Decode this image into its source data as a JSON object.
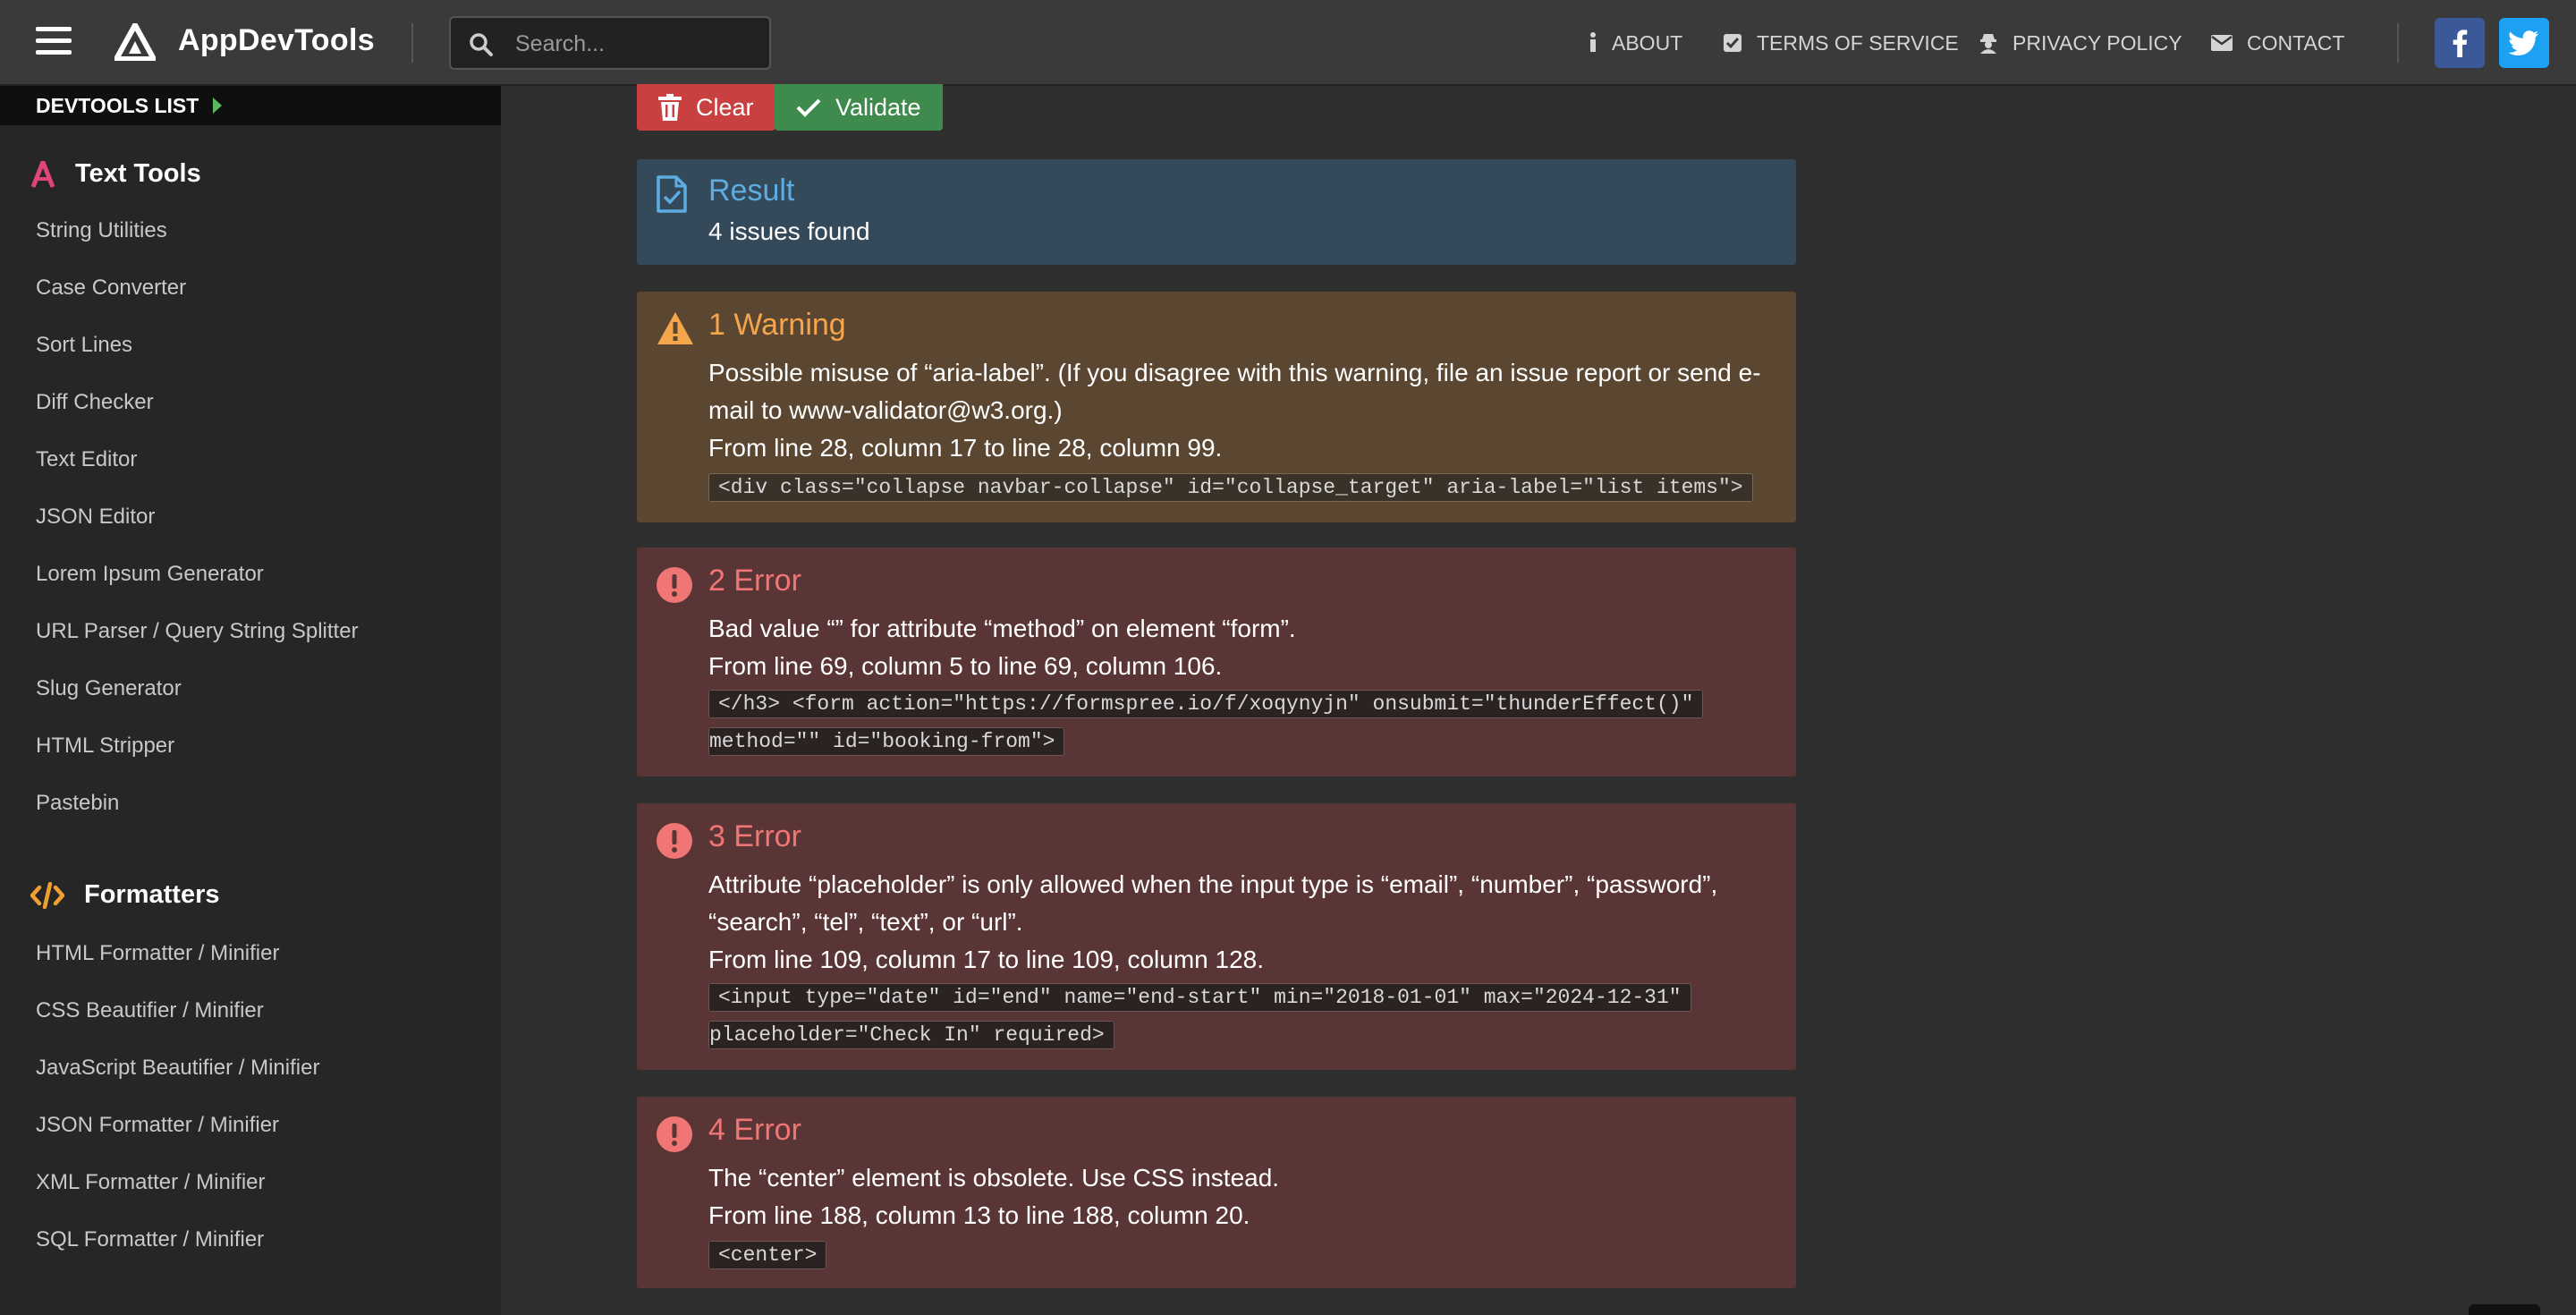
{
  "app": {
    "name": "AppDevTools"
  },
  "search": {
    "placeholder": "Search..."
  },
  "nav": {
    "about": "ABOUT",
    "terms": "TERMS OF SERVICE",
    "privacy": "PRIVACY POLICY",
    "contact": "CONTACT"
  },
  "social": {
    "facebook_color": "#3b5998",
    "twitter_color": "#1da1f2"
  },
  "sidebar": {
    "header": "DEVTOOLS LIST",
    "sections": [
      {
        "title": "Text Tools",
        "icon": "letter-a-icon",
        "items": [
          "String Utilities",
          "Case Converter",
          "Sort Lines",
          "Diff Checker",
          "Text Editor",
          "JSON Editor",
          "Lorem Ipsum Generator",
          "URL Parser / Query String Splitter",
          "Slug Generator",
          "HTML Stripper",
          "Pastebin"
        ]
      },
      {
        "title": "Formatters",
        "icon": "code-icon",
        "items": [
          "HTML Formatter / Minifier",
          "CSS Beautifier / Minifier",
          "JavaScript Beautifier / Minifier",
          "JSON Formatter / Minifier",
          "XML Formatter / Minifier",
          "SQL Formatter / Minifier"
        ]
      }
    ]
  },
  "toolbar": {
    "clear_label": "Clear",
    "validate_label": "Validate"
  },
  "result": {
    "title": "Result",
    "summary": "4 issues found"
  },
  "issues": [
    {
      "title": "1 Warning",
      "type": "warning",
      "message": [
        "Possible misuse of “aria-label”. (If you disagree with this warning, file an issue report or send e-",
        "mail to www-validator@w3.org.)"
      ],
      "location": "From line 28, column 17 to line 28, column 99.",
      "code": [
        "<div class=\"collapse navbar-collapse\" id=\"collapse_target\" aria-label=\"list items\">"
      ]
    },
    {
      "title": "2 Error",
      "type": "error",
      "message": [
        "Bad value “” for attribute “method” on element “form”."
      ],
      "location": "From line 69, column 5 to line 69, column 106.",
      "code": [
        "</h3> <form action=\"https://formspree.io/f/xoqynyjn\" onsubmit=\"thunderEffect()\"",
        "method=\"\" id=\"booking-from\">"
      ]
    },
    {
      "title": "3 Error",
      "type": "error",
      "message": [
        "Attribute “placeholder” is only allowed when the input type is “email”, “number”, “password”,",
        "“search”, “tel”, “text”, or “url”."
      ],
      "location": "From line 109, column 17 to line 109, column 128.",
      "code": [
        "<input type=\"date\" id=\"end\" name=\"end-start\" min=\"2018-01-01\" max=\"2024-12-31\"",
        "placeholder=\"Check In\" required>"
      ]
    },
    {
      "title": "4 Error",
      "type": "error",
      "message": [
        "The “center” element is obsolete. Use CSS instead."
      ],
      "location": "From line 188, column 13 to line 188, column 20.",
      "code": [
        "<center>"
      ]
    }
  ],
  "colors": {
    "result_bg": "#34495a",
    "result_title": "#5dade2",
    "warning_bg": "#5b4731",
    "warning_title": "#f5a54a",
    "error_bg": "#5a3535",
    "error_title": "#f07575",
    "clear_btn": "#c94040",
    "validate_btn": "#3f8a4d"
  }
}
